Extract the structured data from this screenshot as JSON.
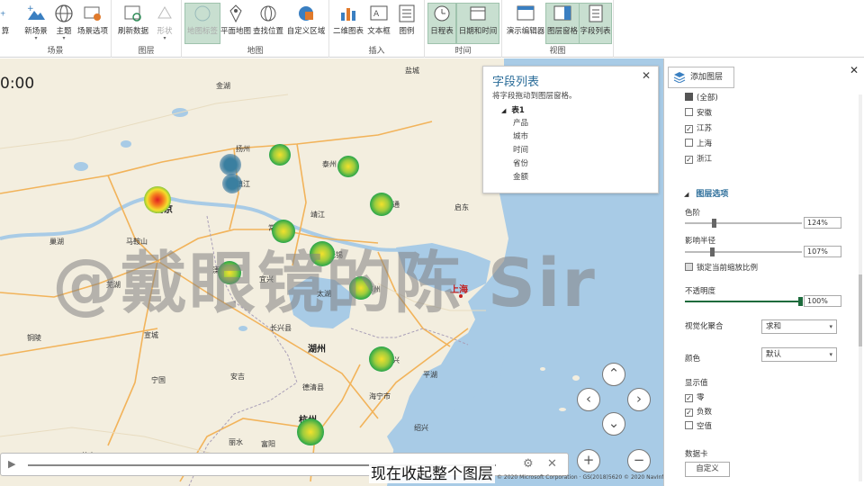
{
  "ribbon": {
    "groups": [
      {
        "label": "场景"
      },
      {
        "label": "图层"
      },
      {
        "label": "地图"
      },
      {
        "label": "插入"
      },
      {
        "label": "时间"
      },
      {
        "label": "视图"
      }
    ],
    "buttons": {
      "edge": "算",
      "new_scene": "新场景",
      "theme": "主题",
      "scene_options": "场景选项",
      "refresh": "刷新数据",
      "shape": "形状",
      "map_labels": "地图标签",
      "flat_map": "平面地图",
      "find_location": "查找位置",
      "custom_region": "自定义区域",
      "chart_2d": "二维图表",
      "text_box": "文本框",
      "legend": "图例",
      "timeline": "日程表",
      "date_time": "日期和时间",
      "tour_editor": "演示编辑器",
      "layer_pane": "图层窗格",
      "field_list": "字段列表"
    }
  },
  "map": {
    "time_readout": "0:00",
    "cities": {
      "shanghai": "上海",
      "hangzhou": "杭州",
      "jiaxing": "嘉兴",
      "nantong": "南通",
      "wuxi": "无锡",
      "suzhou": "苏州",
      "taizhou": "泰州",
      "nanjing": "南京",
      "zhenjiang": "镇江",
      "changzhou": "常州",
      "yangzhou": "扬州",
      "yancheng": "盐城",
      "maanshan": "马鞍山",
      "wuhu": "芜湖",
      "xuancheng": "宣城",
      "huzhou": "湖州",
      "ningguo": "宁国",
      "huangshan": "黄山",
      "changxing": "长兴县",
      "tongling": "铜陵",
      "chaohu": "巢湖",
      "taihu": "太湖",
      "pinghu": "平湖",
      "haining": "海宁市",
      "deqing": "德清县",
      "fuyang": "富阳",
      "jiande": "建德",
      "lishui": "丽水",
      "shaoxing": "绍兴",
      "anji": "安吉",
      "yixing": "宜兴",
      "liyang": "溧阳",
      "jinhu": "金湖",
      "jingjiang": "靖江",
      "qidong": "启东"
    },
    "watermark": "@戴眼镜的陈 Sir"
  },
  "field_list": {
    "title": "字段列表",
    "subtitle": "将字段拖动到图层窗格。",
    "table": "表1",
    "fields": [
      "产品",
      "城市",
      "时间",
      "省份",
      "金额"
    ]
  },
  "player": {
    "subtitle": "现在收起整个图层",
    "copyright": "© 2020 Microsoft Corporation · GS(2018)5620 © 2020 NavInfo"
  },
  "panel": {
    "add_layer": "添加图层",
    "filters": [
      {
        "label": "(全部)",
        "checked": "partial"
      },
      {
        "label": "安徽",
        "checked": false
      },
      {
        "label": "江苏",
        "checked": true
      },
      {
        "label": "上海",
        "checked": false
      },
      {
        "label": "浙江",
        "checked": true
      }
    ],
    "layer_options_title": "图层选项",
    "color_scale_label": "色阶",
    "color_scale_value": "124%",
    "radius_label": "影响半径",
    "radius_value": "107%",
    "lock_scale_label": "锁定当前缩放比例",
    "opacity_label": "不透明度",
    "opacity_value": "100%",
    "aggregation_label": "视觉化聚合",
    "aggregation_value": "求和",
    "color_label": "颜色",
    "color_value": "默认",
    "show_values_label": "显示值",
    "show_values": [
      {
        "label": "零",
        "checked": true
      },
      {
        "label": "负数",
        "checked": true
      },
      {
        "label": "空值",
        "checked": false
      }
    ],
    "data_card_label": "数据卡",
    "custom_button": "自定义"
  }
}
